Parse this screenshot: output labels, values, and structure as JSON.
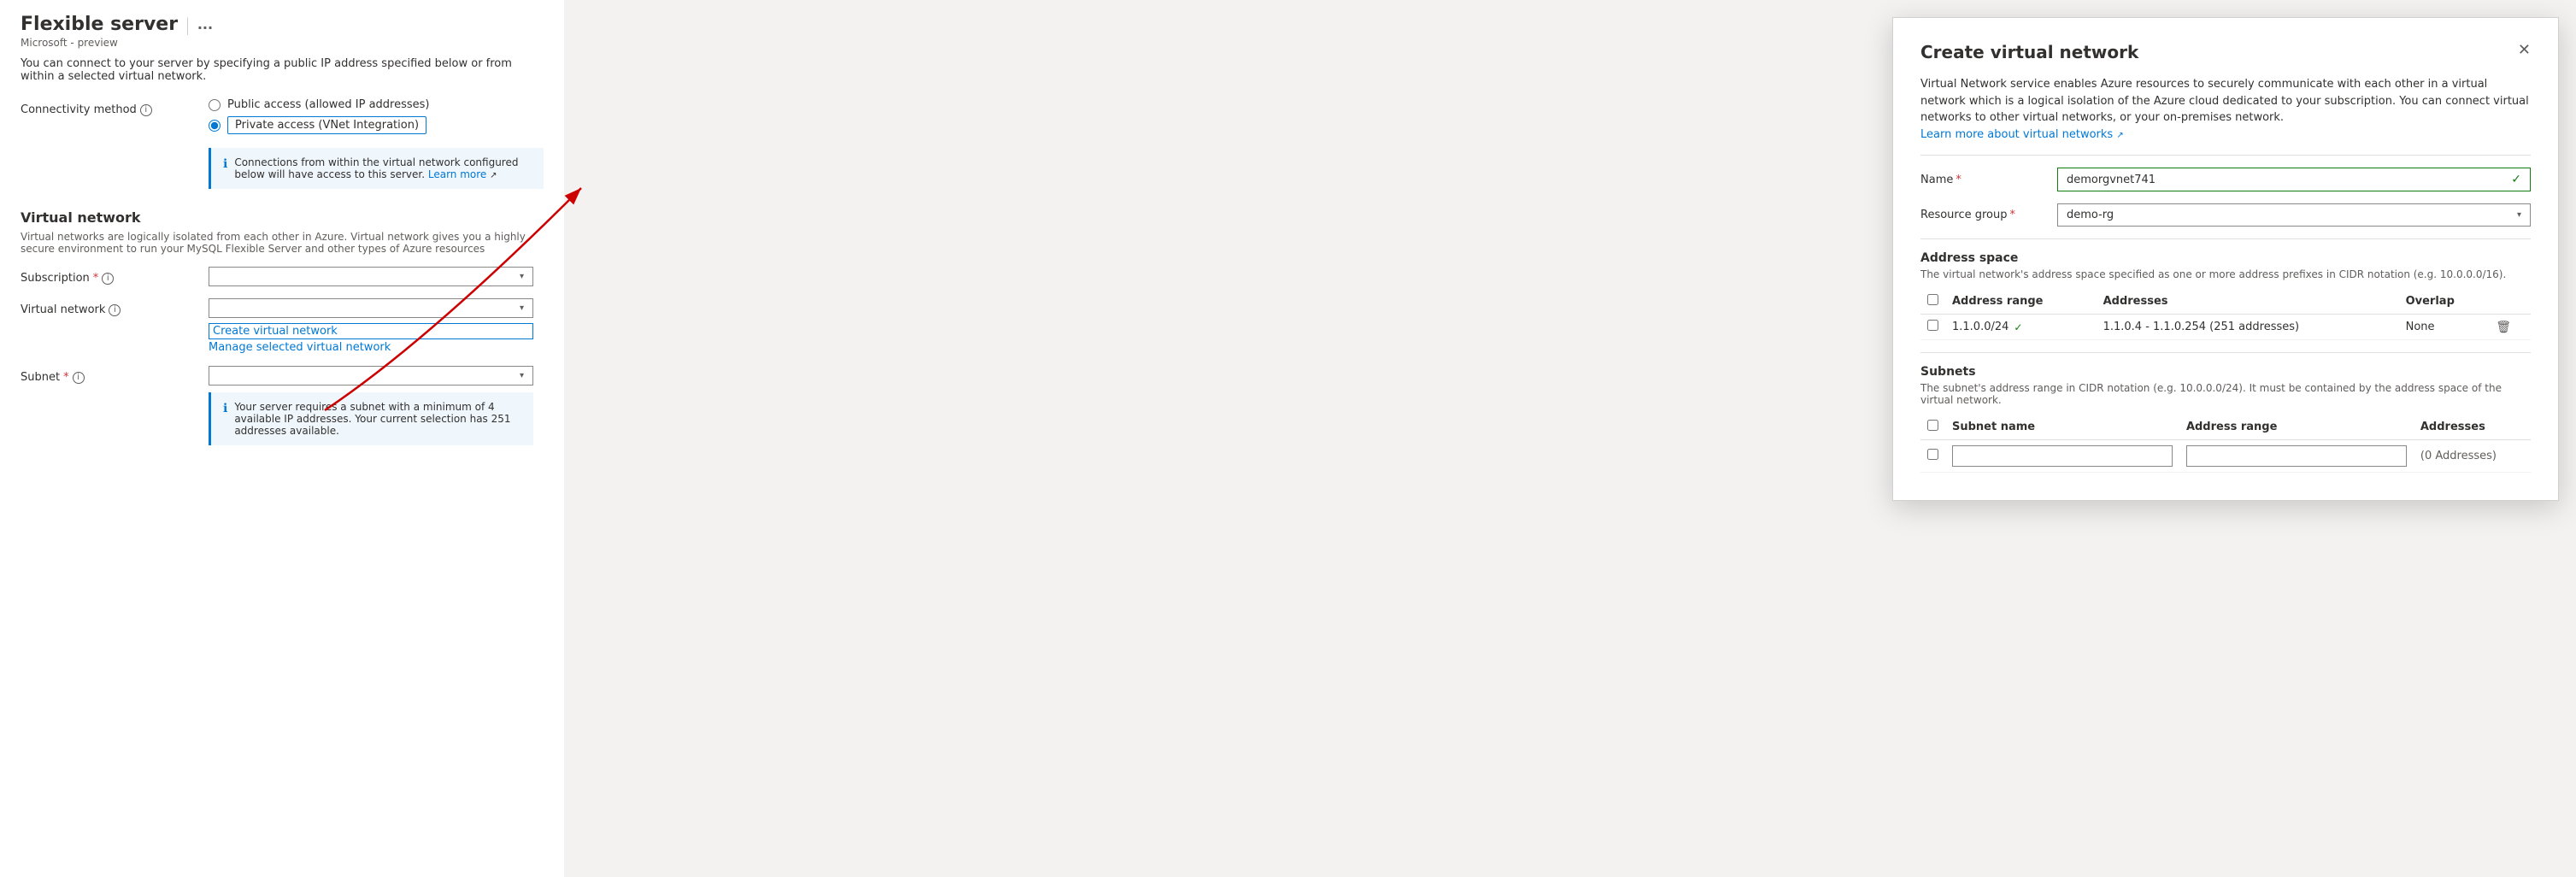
{
  "page": {
    "title": "Flexible server",
    "title_divider": "|",
    "title_more": "...",
    "subtitle": "Microsoft - preview",
    "description": "You can connect to your server by specifying a public IP address specified below or from within a selected virtual network."
  },
  "connectivity": {
    "label": "Connectivity method",
    "option_public": "Public access (allowed IP addresses)",
    "option_private": "Private access (VNet Integration)",
    "selected": "private",
    "info_text": "Connections from within the virtual network configured below will have access to this server.",
    "info_learn_more": "Learn more"
  },
  "virtual_network_section": {
    "title": "Virtual network",
    "description": "Virtual networks are logically isolated from each other in Azure. Virtual network gives you a highly secure environment to run your MySQL Flexible Server and other types of Azure resources"
  },
  "subscription": {
    "label": "Subscription",
    "required": true,
    "value": ""
  },
  "virtual_network": {
    "label": "Virtual network",
    "required": false,
    "value": "",
    "create_link": "Create virtual network",
    "manage_link": "Manage selected virtual network"
  },
  "subnet": {
    "label": "Subnet",
    "required": true,
    "value": "",
    "info_text": "Your server requires a subnet with a minimum of 4 available IP addresses. Your current selection has 251 addresses available."
  },
  "modal": {
    "title": "Create virtual network",
    "description": "Virtual Network service enables Azure resources to securely communicate with each other in a virtual network which is a logical isolation of the Azure cloud dedicated to your subscription. You can connect virtual networks to other virtual networks, or your on-premises network.",
    "learn_more": "Learn more about virtual networks",
    "name_label": "Name",
    "name_required": true,
    "name_value": "demorgvnet741",
    "resource_group_label": "Resource group",
    "resource_group_required": true,
    "resource_group_value": "demo-rg",
    "address_space_title": "Address space",
    "address_space_desc": "The virtual network's address space specified as one or more address prefixes in CIDR notation (e.g. 10.0.0.0/16).",
    "address_table_headers": [
      "Address range",
      "Addresses",
      "Overlap"
    ],
    "address_rows": [
      {
        "range": "1.1.0.0/24",
        "valid": true,
        "addresses": "1.1.0.4 - 1.1.0.254 (251 addresses)",
        "overlap": "None"
      }
    ],
    "subnets_title": "Subnets",
    "subnets_desc": "The subnet's address range in CIDR notation (e.g. 10.0.0.0/24). It must be contained by the address space of the virtual network.",
    "subnet_table_headers": [
      "Subnet name",
      "Address range",
      "Addresses"
    ],
    "subnet_rows": [
      {
        "name": "",
        "address_range": "",
        "addresses": "(0 Addresses)"
      }
    ]
  }
}
